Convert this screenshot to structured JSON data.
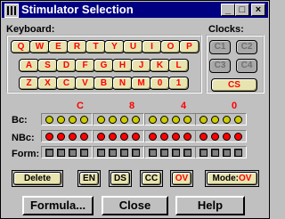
{
  "window": {
    "title": "Stimulator Selection",
    "minimize_label": "_",
    "maximize_label": "□",
    "close_label": "×"
  },
  "keyboard": {
    "label": "Keyboard:",
    "rows": [
      [
        "Q",
        "W",
        "E",
        "R",
        "T",
        "Y",
        "U",
        "I",
        "O",
        "P"
      ],
      [
        "A",
        "S",
        "D",
        "F",
        "G",
        "H",
        "J",
        "K",
        "L"
      ],
      [
        "Z",
        "X",
        "C",
        "V",
        "B",
        "N",
        "M",
        "0",
        "1"
      ]
    ]
  },
  "clocks": {
    "label": "Clocks:",
    "keys": [
      "C1",
      "C2",
      "C3",
      "C4"
    ],
    "cs_label": "CS"
  },
  "hex_digits": [
    "C",
    "8",
    "4",
    "0"
  ],
  "rows": {
    "bc_label": "Bc:",
    "nbc_label": "NBc:",
    "form_label": "Form:"
  },
  "buttons": {
    "delete": "Delete",
    "en": "EN",
    "ds": "DS",
    "cc": "CC",
    "ov": "OV",
    "mode_prefix": "Mode:",
    "mode_value": "OV",
    "formula": "Formula...",
    "close": "Close",
    "help": "Help"
  }
}
